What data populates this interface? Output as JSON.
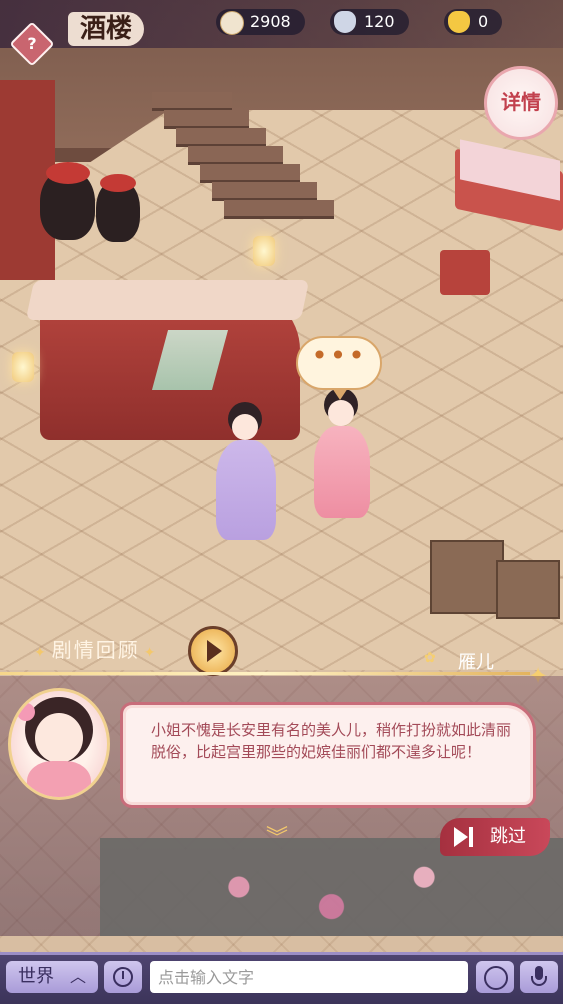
{
  "header": {
    "help_symbol": "?",
    "title": "酒楼",
    "resources": [
      {
        "icon": "coin-icon",
        "value": "2908"
      },
      {
        "icon": "silver-ingot-icon",
        "value": "120"
      },
      {
        "icon": "gold-ingot-icon",
        "value": "0"
      }
    ],
    "detail_button": "详情"
  },
  "scene": {
    "speech_bubble": "•••"
  },
  "story": {
    "recap_label": "剧情回顾",
    "speaker_name": "雁儿",
    "dialogue": "小姐不愧是长安里有名的美人儿，稍作打扮就如此清丽脱俗，比起宫里那些的妃嫔佳丽们都不遑多让呢！",
    "skip_label": "跳过"
  },
  "chat": {
    "channel": "世界",
    "input_placeholder": "点击输入文字"
  },
  "colors": {
    "dialog_text": "#a34a58",
    "dialog_border": "#c86d7a",
    "chat_bar": "#4e4470",
    "skip_button": "#a5303f"
  }
}
